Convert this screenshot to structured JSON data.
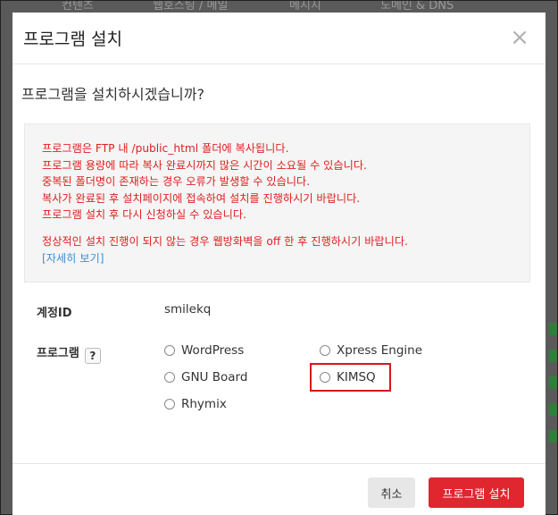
{
  "background": {
    "tabs": [
      "컨텐츠",
      "웹호스팅 / 메일",
      "메시지",
      "도메인 & DNS"
    ]
  },
  "modal": {
    "title": "프로그램 설치",
    "close_icon": "close-icon",
    "question": "프로그램을 설치하시겠습니까?",
    "notice": {
      "lines": [
        "프로그램은 FTP 내 /public_html 폴더에 복사됩니다.",
        "프로그램 용량에 따라 복사 완료시까지 많은 시간이 소요될 수 있습니다.",
        "중복된 폴더명이 존재하는 경우 오류가 발생할 수 있습니다.",
        "복사가 완료된 후 설치페이지에 접속하여 설치를 진행하시기 바랍니다.",
        "프로그램 설치 후 다시 신청하실 수 있습니다."
      ],
      "warning": "정상적인 설치 진행이 되지 않는 경우 웹방화벽을 off 한 후 진행하시기 바랍니다.",
      "more_link": "[자세히 보기]"
    },
    "account": {
      "label": "계정ID",
      "value": "smilekq"
    },
    "program": {
      "label": "프로그램",
      "help": "?",
      "options": [
        "WordPress",
        "Xpress Engine",
        "GNU Board",
        "KIMSQ",
        "Rhymix"
      ],
      "highlighted": "KIMSQ"
    },
    "buttons": {
      "cancel": "취소",
      "install": "프로그램 설치"
    }
  },
  "colors": {
    "accent": "#e0262e",
    "notice_text": "#e02020",
    "link": "#3a8fd8",
    "highlight_border": "#d21a1a"
  }
}
